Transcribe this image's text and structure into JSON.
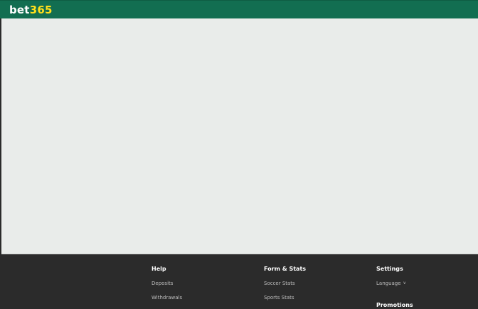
{
  "header": {
    "logo_part1": "bet",
    "logo_part2": "365"
  },
  "footer": {
    "help": {
      "heading": "Help",
      "links": [
        "Deposits",
        "Withdrawals"
      ]
    },
    "form_stats": {
      "heading": "Form & Stats",
      "links": [
        "Soccer Stats",
        "Sports Stats"
      ]
    },
    "settings": {
      "heading": "Settings",
      "language_label": "Language",
      "language_icon": "chevron-down-icon"
    },
    "promotions": {
      "heading": "Promotions"
    }
  },
  "colors": {
    "brand_green": "#126e51",
    "brand_yellow": "#ffdf1b",
    "content_bg": "#e9ecea",
    "footer_bg": "#2b2b2b"
  }
}
